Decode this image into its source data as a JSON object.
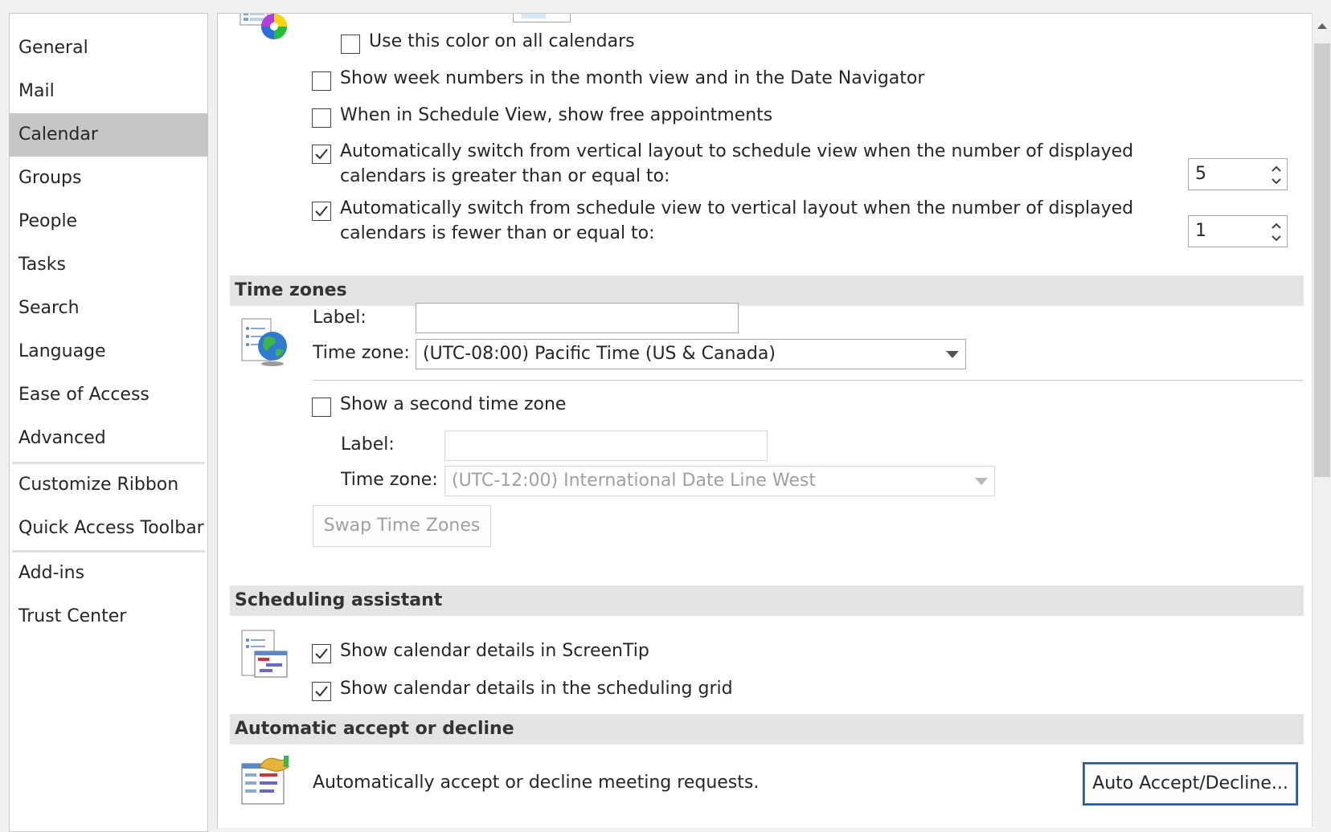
{
  "sidebar": {
    "items": [
      {
        "label": "General"
      },
      {
        "label": "Mail"
      },
      {
        "label": "Calendar"
      },
      {
        "label": "Groups"
      },
      {
        "label": "People"
      },
      {
        "label": "Tasks"
      },
      {
        "label": "Search"
      },
      {
        "label": "Language"
      },
      {
        "label": "Ease of Access"
      },
      {
        "label": "Advanced"
      },
      {
        "label": "Customize Ribbon"
      },
      {
        "label": "Quick Access Toolbar"
      },
      {
        "label": "Add-ins"
      },
      {
        "label": "Trust Center"
      }
    ],
    "selected": "Calendar"
  },
  "calendar_options": {
    "use_color_all": {
      "label": "Use this color on all calendars",
      "checked": false
    },
    "week_numbers": {
      "label": "Show week numbers in the month view and in the Date Navigator",
      "checked": false
    },
    "free_appointments": {
      "label": "When in Schedule View, show free appointments",
      "checked": false
    },
    "switch_to_schedule": {
      "line1": "Automatically switch from vertical layout to schedule view when the number of displayed",
      "line2": "calendars is greater than or equal to:",
      "checked": true,
      "value": "5"
    },
    "switch_to_vertical": {
      "line1": "Automatically switch from schedule view to vertical layout when the number of displayed",
      "line2": "calendars is fewer than or equal to:",
      "checked": true,
      "value": "1"
    }
  },
  "time_zones": {
    "header": "Time zones",
    "label_caption": "Label:",
    "label_value": "",
    "zone_caption": "Time zone:",
    "zone_value": "(UTC-08:00) Pacific Time (US & Canada)",
    "second_zone": {
      "label": "Show a second time zone",
      "checked": false
    },
    "second_label_caption": "Label:",
    "second_label_value": "",
    "second_zone_caption": "Time zone:",
    "second_zone_value": "(UTC-12:00) International Date Line West",
    "swap_button": "Swap Time Zones"
  },
  "scheduling_assistant": {
    "header": "Scheduling assistant",
    "screentip": {
      "label": "Show calendar details in ScreenTip",
      "checked": true
    },
    "grid": {
      "label": "Show calendar details in the scheduling grid",
      "checked": true
    }
  },
  "auto_accept": {
    "header": "Automatic accept or decline",
    "description": "Automatically accept or decline meeting requests.",
    "button": "Auto Accept/Decline..."
  }
}
